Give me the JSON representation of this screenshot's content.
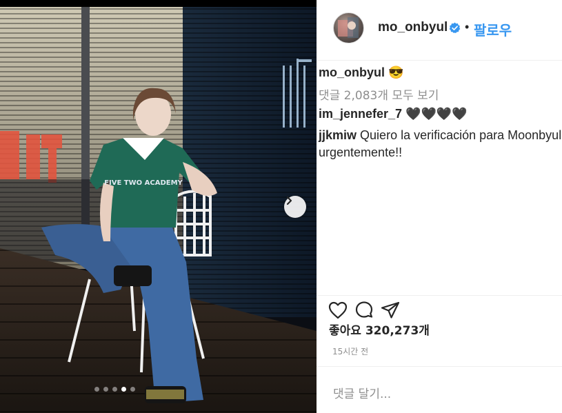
{
  "post": {
    "username": "mo_onbyul",
    "follow_label": "팔로우",
    "separator": "•",
    "caption_user": "mo_onbyul",
    "caption_text": "😎",
    "view_all_comments": "댓글 2,083개 모두 보기",
    "comments": [
      {
        "user": "im_jennefer_7",
        "text": "🖤🖤🖤🖤"
      },
      {
        "user": "jjkmiw",
        "text": "Quiero la verificación para Moonbyul",
        "text_cont": "urgentemente!!"
      }
    ],
    "likes_label": "좋아요 320,273개",
    "timestamp": "15시간 전",
    "comment_placeholder": "댓글 달기...",
    "carousel": {
      "count": 5,
      "active_index": 3
    },
    "photo_text": {
      "jersey": "FIVE TWO ACADEMY"
    }
  },
  "icons": {
    "like": "heart-icon",
    "comment": "comment-icon",
    "share": "send-icon",
    "verified": "verified-badge-icon",
    "next": "chevron-right-icon"
  },
  "colors": {
    "link": "#3897f0",
    "verified": "#3897f0",
    "muted": "#8e8e8e",
    "text": "#262626",
    "divider": "#efefef"
  }
}
